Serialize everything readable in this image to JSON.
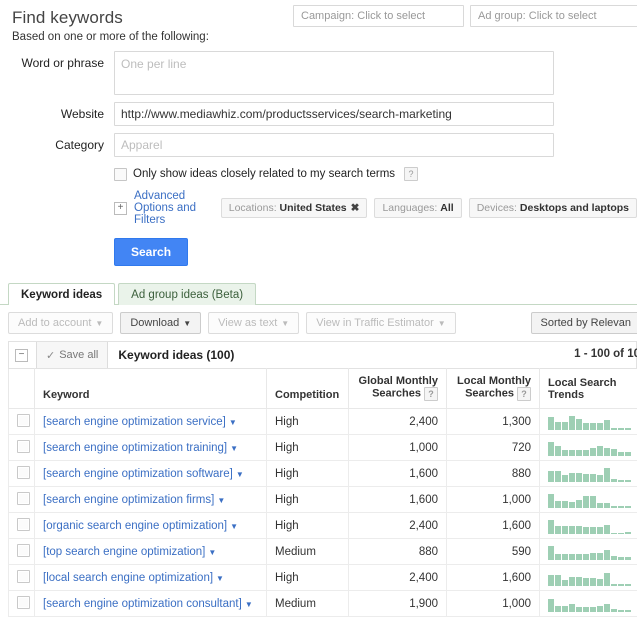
{
  "header": {
    "title": "Find keywords",
    "subtitle": "Based on one or more of the following:",
    "campaign_selector": "Campaign: Click to select",
    "adgroup_selector": "Ad group: Click to select"
  },
  "form": {
    "word_label": "Word or phrase",
    "word_placeholder": "One per line",
    "word_value": "",
    "website_label": "Website",
    "website_value": "http://www.mediawhiz.com/productsservices/search-marketing",
    "category_label": "Category",
    "category_placeholder": "Apparel",
    "category_value": "",
    "closely_related_label": "Only show ideas closely related to my search terms",
    "help_glyph": "?",
    "advanced_link": "Advanced Options and Filters",
    "expander_glyph": "+",
    "chips": [
      {
        "label": "Locations:",
        "value": "United States",
        "removable": true,
        "remove_glyph": "✖"
      },
      {
        "label": "Languages:",
        "value": "All",
        "removable": false,
        "remove_glyph": ""
      },
      {
        "label": "Devices:",
        "value": "Desktops and laptops",
        "removable": false,
        "remove_glyph": ""
      }
    ],
    "search_button": "Search"
  },
  "tabs": [
    {
      "label": "Keyword ideas",
      "active": true
    },
    {
      "label": "Ad group ideas (Beta)",
      "active": false
    }
  ],
  "toolbar": {
    "buttons": [
      {
        "label": "Add to account",
        "state": "disabled",
        "caret": "▼"
      },
      {
        "label": "Download",
        "state": "enabled",
        "caret": "▼"
      },
      {
        "label": "View as text",
        "state": "disabled",
        "caret": "▼"
      },
      {
        "label": "View in Traffic Estimator",
        "state": "disabled",
        "caret": "▼"
      }
    ],
    "sort_label": "Sorted by Relevan",
    "sort_caret": ""
  },
  "results": {
    "collapse_glyph": "−",
    "save_all_label": "Save all",
    "save_all_check": "✓",
    "ideas_title": "Keyword ideas (100)",
    "pagination": "1 - 100 of 10",
    "columns": {
      "keyword": "Keyword",
      "competition": "Competition",
      "global_monthly_searches": "Global Monthly Searches",
      "local_monthly_searches": "Local Monthly Searches",
      "local_search_trends": "Local Search Trends"
    },
    "dropdown_glyph": "▼",
    "rows": [
      {
        "keyword": "[search engine optimization service]",
        "competition": "High",
        "global_monthly_searches": "2,400",
        "local_monthly_searches": "1,300",
        "trend": [
          13,
          8,
          8,
          14,
          11,
          7,
          7,
          7,
          10,
          2,
          2,
          2
        ]
      },
      {
        "keyword": "[search engine optimization training]",
        "competition": "High",
        "global_monthly_searches": "1,000",
        "local_monthly_searches": "720",
        "trend": [
          14,
          10,
          6,
          6,
          6,
          6,
          8,
          10,
          8,
          7,
          4,
          4
        ]
      },
      {
        "keyword": "[search engine optimization software]",
        "competition": "High",
        "global_monthly_searches": "1,600",
        "local_monthly_searches": "880",
        "trend": [
          11,
          11,
          7,
          9,
          9,
          8,
          8,
          7,
          14,
          3,
          2,
          2
        ]
      },
      {
        "keyword": "[search engine optimization firms]",
        "competition": "High",
        "global_monthly_searches": "1,600",
        "local_monthly_searches": "1,000",
        "trend": [
          14,
          7,
          7,
          6,
          8,
          12,
          12,
          5,
          5,
          2,
          2,
          2
        ]
      },
      {
        "keyword": "[organic search engine optimization]",
        "competition": "High",
        "global_monthly_searches": "2,400",
        "local_monthly_searches": "1,600",
        "trend": [
          14,
          8,
          8,
          8,
          8,
          7,
          7,
          7,
          9,
          1,
          1,
          2
        ]
      },
      {
        "keyword": "[top search engine optimization]",
        "competition": "Medium",
        "global_monthly_searches": "880",
        "local_monthly_searches": "590",
        "trend": [
          14,
          6,
          6,
          6,
          6,
          6,
          7,
          7,
          10,
          4,
          3,
          3
        ]
      },
      {
        "keyword": "[local search engine optimization]",
        "competition": "High",
        "global_monthly_searches": "2,400",
        "local_monthly_searches": "1,600",
        "trend": [
          11,
          11,
          6,
          9,
          9,
          8,
          8,
          7,
          13,
          2,
          2,
          2
        ]
      },
      {
        "keyword": "[search engine optimization consultant]",
        "competition": "Medium",
        "global_monthly_searches": "1,900",
        "local_monthly_searches": "1,000",
        "trend": [
          13,
          6,
          6,
          8,
          5,
          5,
          5,
          6,
          8,
          3,
          2,
          2
        ]
      }
    ]
  },
  "colors": {
    "accent_blue": "#4285f4",
    "link_blue": "#3b6fc4",
    "trend_green": "#9ecfb4",
    "tab_green": "#c4d8c4"
  }
}
